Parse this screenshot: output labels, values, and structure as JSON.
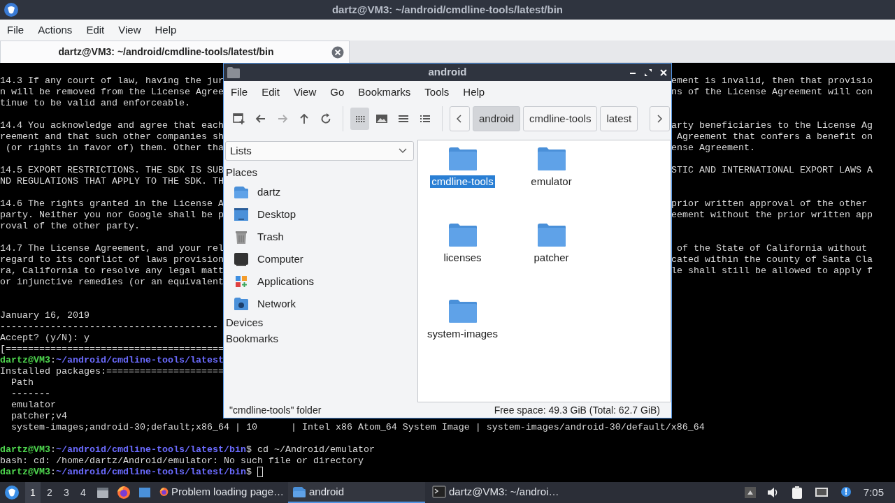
{
  "terminal": {
    "title": "dartz@VM3: ~/android/cmdline-tools/latest/bin",
    "menu": [
      "File",
      "Actions",
      "Edit",
      "View",
      "Help"
    ],
    "tabs": [
      {
        "label": "dartz@VM3: ~/android/cmdline-tools/latest/bin",
        "selected": true
      }
    ],
    "lines": [
      {
        "kind": "text",
        "left": "14.3 If any court of law, having the jur",
        "right": "ement is invalid, then that provisio"
      },
      {
        "kind": "text",
        "left": "n will be removed from the License Agree",
        "right": "ns of the License Agreement will con"
      },
      {
        "kind": "text",
        "left": "tinue to be valid and enforceable."
      },
      {
        "kind": "blank"
      },
      {
        "kind": "text",
        "left": "14.4 You acknowledge and agree that each",
        "right": "arty beneficiaries to the License Ag"
      },
      {
        "kind": "text",
        "left": "reement and that such other companies sh",
        "right": " Agreement that confers a benefit on"
      },
      {
        "kind": "text",
        "left": " (or rights in favor of) them. Other tha",
        "right": "ense Agreement."
      },
      {
        "kind": "blank"
      },
      {
        "kind": "text",
        "left": "14.5 EXPORT RESTRICTIONS. THE SDK IS SUB",
        "right": "STIC AND INTERNATIONAL EXPORT LAWS A"
      },
      {
        "kind": "text",
        "left": "ND REGULATIONS THAT APPLY TO THE SDK. TH"
      },
      {
        "kind": "blank"
      },
      {
        "kind": "text",
        "left": "14.6 The rights granted in the License A",
        "right": "prior written approval of the other"
      },
      {
        "kind": "text",
        "left": "party. Neither you nor Google shall be p",
        "right": "eement without the prior written app"
      },
      {
        "kind": "text",
        "left": "roval of the other party."
      },
      {
        "kind": "blank"
      },
      {
        "kind": "text",
        "left": "14.7 The License Agreement, and your rel",
        "right": " of the State of California without"
      },
      {
        "kind": "text",
        "left": "regard to its conflict of laws provision",
        "right": "cated within the county of Santa Cla"
      },
      {
        "kind": "text",
        "left": "ra, California to resolve any legal matt",
        "right": "le shall still be allowed to apply f"
      },
      {
        "kind": "text",
        "left": "or injunctive remedies (or an equivalent"
      },
      {
        "kind": "blank"
      },
      {
        "kind": "blank"
      },
      {
        "kind": "text",
        "left": "January 16, 2019"
      },
      {
        "kind": "text",
        "left": "---------------------------------------"
      },
      {
        "kind": "text",
        "left": "Accept? (y/N): y"
      },
      {
        "kind": "text",
        "left": "[======================================="
      },
      {
        "kind": "prompt",
        "user": "dartz@VM3",
        "sep": ":",
        "path": "~/android/cmdline-tools/latest"
      },
      {
        "kind": "text",
        "left": "Installed packages:====================="
      },
      {
        "kind": "text",
        "left": "  Path"
      },
      {
        "kind": "text",
        "left": "  -------"
      },
      {
        "kind": "text",
        "left": "  emulator"
      },
      {
        "kind": "text",
        "left": "  patcher;v4"
      },
      {
        "kind": "text",
        "left": "  system-images;android-30;default;x86_64 | 10      | Intel x86 Atom_64 System Image | system-images/android-30/default/x86_64"
      },
      {
        "kind": "blank"
      },
      {
        "kind": "prompt",
        "user": "dartz@VM3",
        "sep": ":",
        "path": "~/android/cmdline-tools/latest/bin",
        "command": "$ cd ~/Android/emulator"
      },
      {
        "kind": "text",
        "left": "bash: cd: /home/dartz/Android/emulator: No such file or directory"
      },
      {
        "kind": "prompt",
        "user": "dartz@VM3",
        "sep": ":",
        "path": "~/android/cmdline-tools/latest/bin",
        "command": "$ ",
        "cursor": true
      }
    ]
  },
  "file_manager": {
    "title": "android",
    "menu": [
      "File",
      "Edit",
      "View",
      "Go",
      "Bookmarks",
      "Tools",
      "Help"
    ],
    "toolbar": [
      {
        "kind": "new-tab",
        "disabled": false
      },
      {
        "kind": "back",
        "disabled": false
      },
      {
        "kind": "forward",
        "disabled": true
      },
      {
        "kind": "up",
        "disabled": false
      },
      {
        "kind": "reload",
        "disabled": false
      }
    ],
    "view_modes": [
      {
        "kind": "icons",
        "selected": true
      },
      {
        "kind": "thumbnails",
        "selected": false
      },
      {
        "kind": "compact",
        "selected": false
      },
      {
        "kind": "details",
        "selected": false
      }
    ],
    "path": [
      {
        "label": "android",
        "selected": true
      },
      {
        "label": "cmdline-tools",
        "selected": false
      },
      {
        "label": "latest",
        "selected": false
      }
    ],
    "side_pane_mode": "Lists",
    "sections": [
      {
        "label": "Places",
        "items": [
          {
            "label": "dartz",
            "kind": "home"
          },
          {
            "label": "Desktop",
            "kind": "desktop"
          },
          {
            "label": "Trash",
            "kind": "trash"
          },
          {
            "label": "Computer",
            "kind": "computer"
          },
          {
            "label": "Applications",
            "kind": "apps"
          },
          {
            "label": "Network",
            "kind": "network"
          }
        ]
      },
      {
        "label": "Devices"
      },
      {
        "label": "Bookmarks"
      }
    ],
    "files": [
      {
        "name": "cmdline-tools",
        "selected": true
      },
      {
        "name": "emulator",
        "selected": false
      },
      {
        "name": "licenses",
        "selected": false
      },
      {
        "name": "patcher",
        "selected": false
      },
      {
        "name": "system-images",
        "selected": false
      }
    ],
    "status": "\"cmdline-tools\" folder",
    "free_space": "Free space: 49.3 GiB (Total: 62.7 GiB)"
  },
  "taskbar": {
    "workspaces": [
      {
        "label": "1",
        "selected": true
      },
      {
        "label": "2",
        "selected": false
      },
      {
        "label": "3",
        "selected": false
      },
      {
        "label": "4",
        "selected": false
      }
    ],
    "launchers": [
      {
        "kind": "files"
      },
      {
        "kind": "browser"
      },
      {
        "kind": "desktop"
      }
    ],
    "tasks": [
      {
        "label": "Problem loading page…",
        "kind": "browser",
        "selected": false
      },
      {
        "label": "android",
        "kind": "folder",
        "selected": true
      },
      {
        "label": "dartz@VM3: ~/androi…",
        "kind": "terminal",
        "selected": false
      }
    ],
    "clock": "7:05"
  }
}
